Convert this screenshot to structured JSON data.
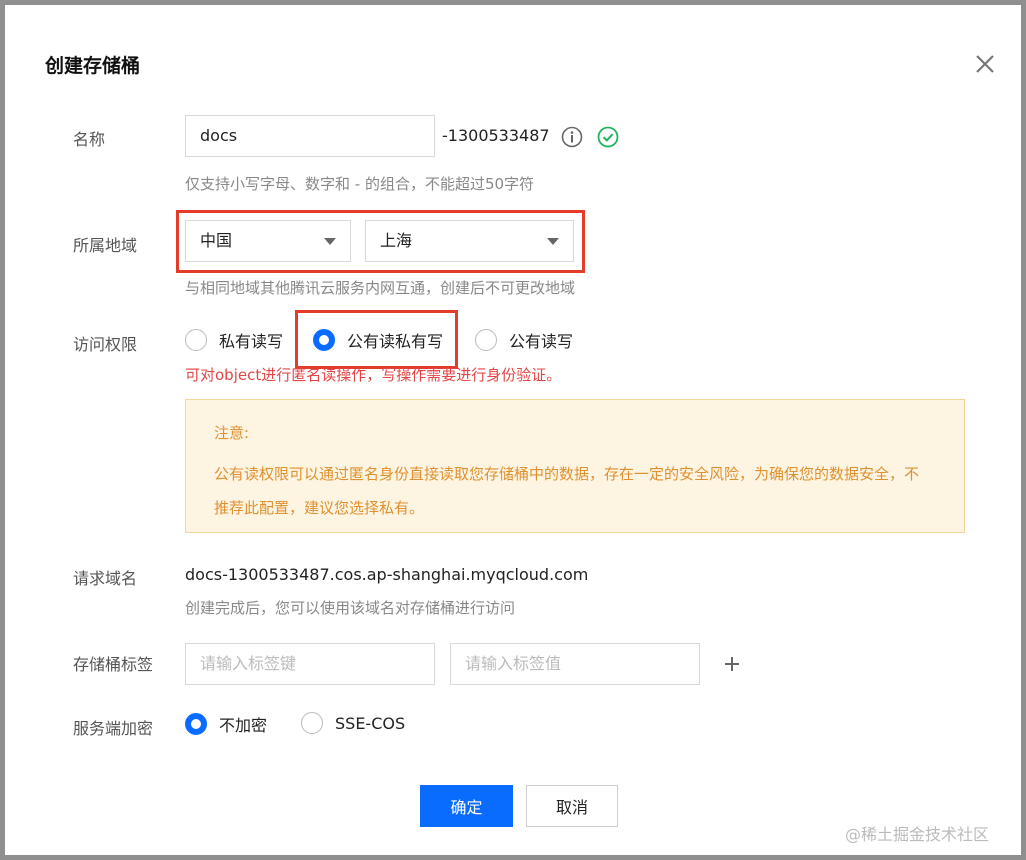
{
  "dialog": {
    "title": "创建存储桶",
    "close_icon": "close-icon"
  },
  "name": {
    "label": "名称",
    "value": "docs",
    "suffix": "-1300533487",
    "hint": "仅支持小写字母、数字和 - 的组合，不能超过50字符",
    "info_icon": "info-icon",
    "valid_icon": "check-circle-icon"
  },
  "region": {
    "label": "所属地域",
    "country": "中国",
    "city": "上海",
    "hint": "与相同地域其他腾讯云服务内网互通，创建后不可更改地域"
  },
  "access": {
    "label": "访问权限",
    "options": [
      "私有读写",
      "公有读私有写",
      "公有读写"
    ],
    "selected_index": 1,
    "warning": "可对object进行匿名读操作，写操作需要进行身份验证。"
  },
  "notice": {
    "title": "注意:",
    "body": "公有读权限可以通过匿名身份直接读取您存储桶中的数据，存在一定的安全风险，为确保您的数据安全，不推荐此配置，建议您选择私有。"
  },
  "endpoint": {
    "label": "请求域名",
    "value": "docs-1300533487.cos.ap-shanghai.myqcloud.com",
    "hint": "创建完成后，您可以使用该域名对存储桶进行访问"
  },
  "tags": {
    "label": "存储桶标签",
    "key_placeholder": "请输入标签键",
    "value_placeholder": "请输入标签值",
    "add_icon": "plus-icon"
  },
  "encryption": {
    "label": "服务端加密",
    "options": [
      "不加密",
      "SSE-COS"
    ],
    "selected_index": 0
  },
  "footer": {
    "confirm_label": "确定",
    "cancel_label": "取消"
  },
  "watermark": "@稀土掘金技术社区",
  "colors": {
    "primary": "#0a6cff",
    "success": "#1db35b",
    "highlight_box": "#e53c2a",
    "warning_text": "#e0912f",
    "error_text": "#e54545"
  }
}
